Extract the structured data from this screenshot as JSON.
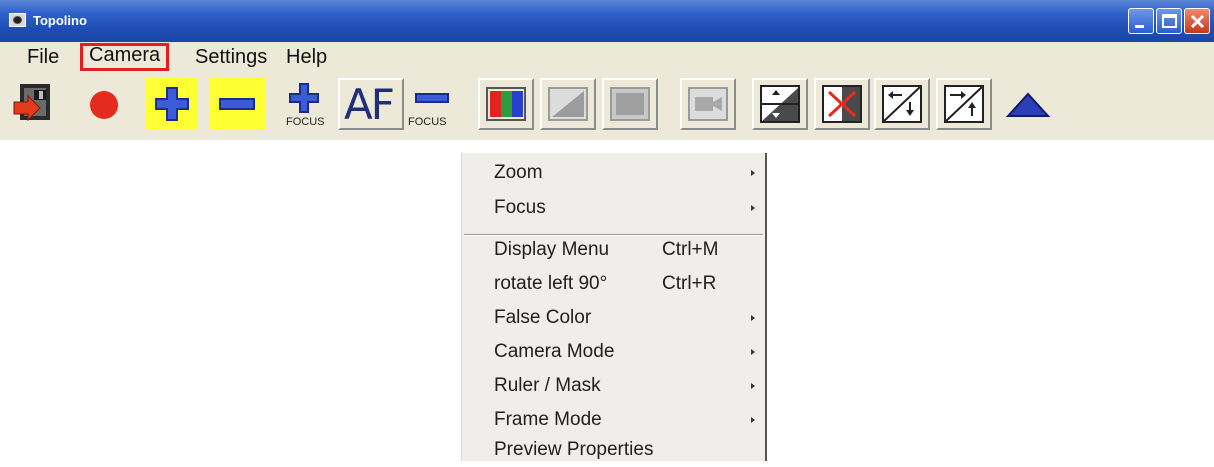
{
  "window": {
    "title": "Topolino",
    "app_icon": "camera-eye-icon",
    "controls": [
      "minimize-icon",
      "maximize-icon",
      "close-icon"
    ]
  },
  "menubar": {
    "items": [
      {
        "label": "File"
      },
      {
        "label": "Camera",
        "highlighted": true
      },
      {
        "label": "Settings"
      },
      {
        "label": "Help"
      }
    ]
  },
  "toolbar": {
    "buttons": [
      {
        "icon": "exit-door-icon"
      },
      {
        "icon": "record-dot-icon"
      },
      {
        "icon": "zoom-in-plus-icon"
      },
      {
        "icon": "zoom-out-minus-icon"
      },
      {
        "icon": "focus-plus-icon",
        "label": "FOCUS"
      },
      {
        "icon": "autofocus-icon",
        "label": "AF"
      },
      {
        "icon": "focus-minus-icon",
        "label": "FOCUS"
      },
      {
        "icon": "color-bars-icon"
      },
      {
        "icon": "gradient-icon"
      },
      {
        "icon": "gray-square-icon"
      },
      {
        "icon": "video-camera-icon"
      },
      {
        "icon": "flip-vertical-icon"
      },
      {
        "icon": "mirror-cross-icon"
      },
      {
        "icon": "rotate-left-icon"
      },
      {
        "icon": "rotate-right-icon"
      },
      {
        "icon": "eject-triangle-icon"
      }
    ]
  },
  "context_menu": {
    "items": [
      {
        "label": "Zoom",
        "submenu": true
      },
      {
        "label": "Focus",
        "submenu": true
      },
      {
        "label": "Display Menu",
        "shortcut": "Ctrl+M"
      },
      {
        "label": "rotate left 90°",
        "shortcut": "Ctrl+R"
      },
      {
        "label": "False Color",
        "submenu": true
      },
      {
        "label": "Camera Mode",
        "submenu": true
      },
      {
        "label": "Ruler / Mask",
        "submenu": true
      },
      {
        "label": "Frame Mode",
        "submenu": true
      },
      {
        "label": "Preview Properties"
      }
    ]
  },
  "colors": {
    "titlebar": "#2f62c9",
    "highlight_border": "#e02020",
    "toolbar_yellow": "#ffff33",
    "record_red": "#e62a1e",
    "icon_blue": "#1f2f7a"
  }
}
